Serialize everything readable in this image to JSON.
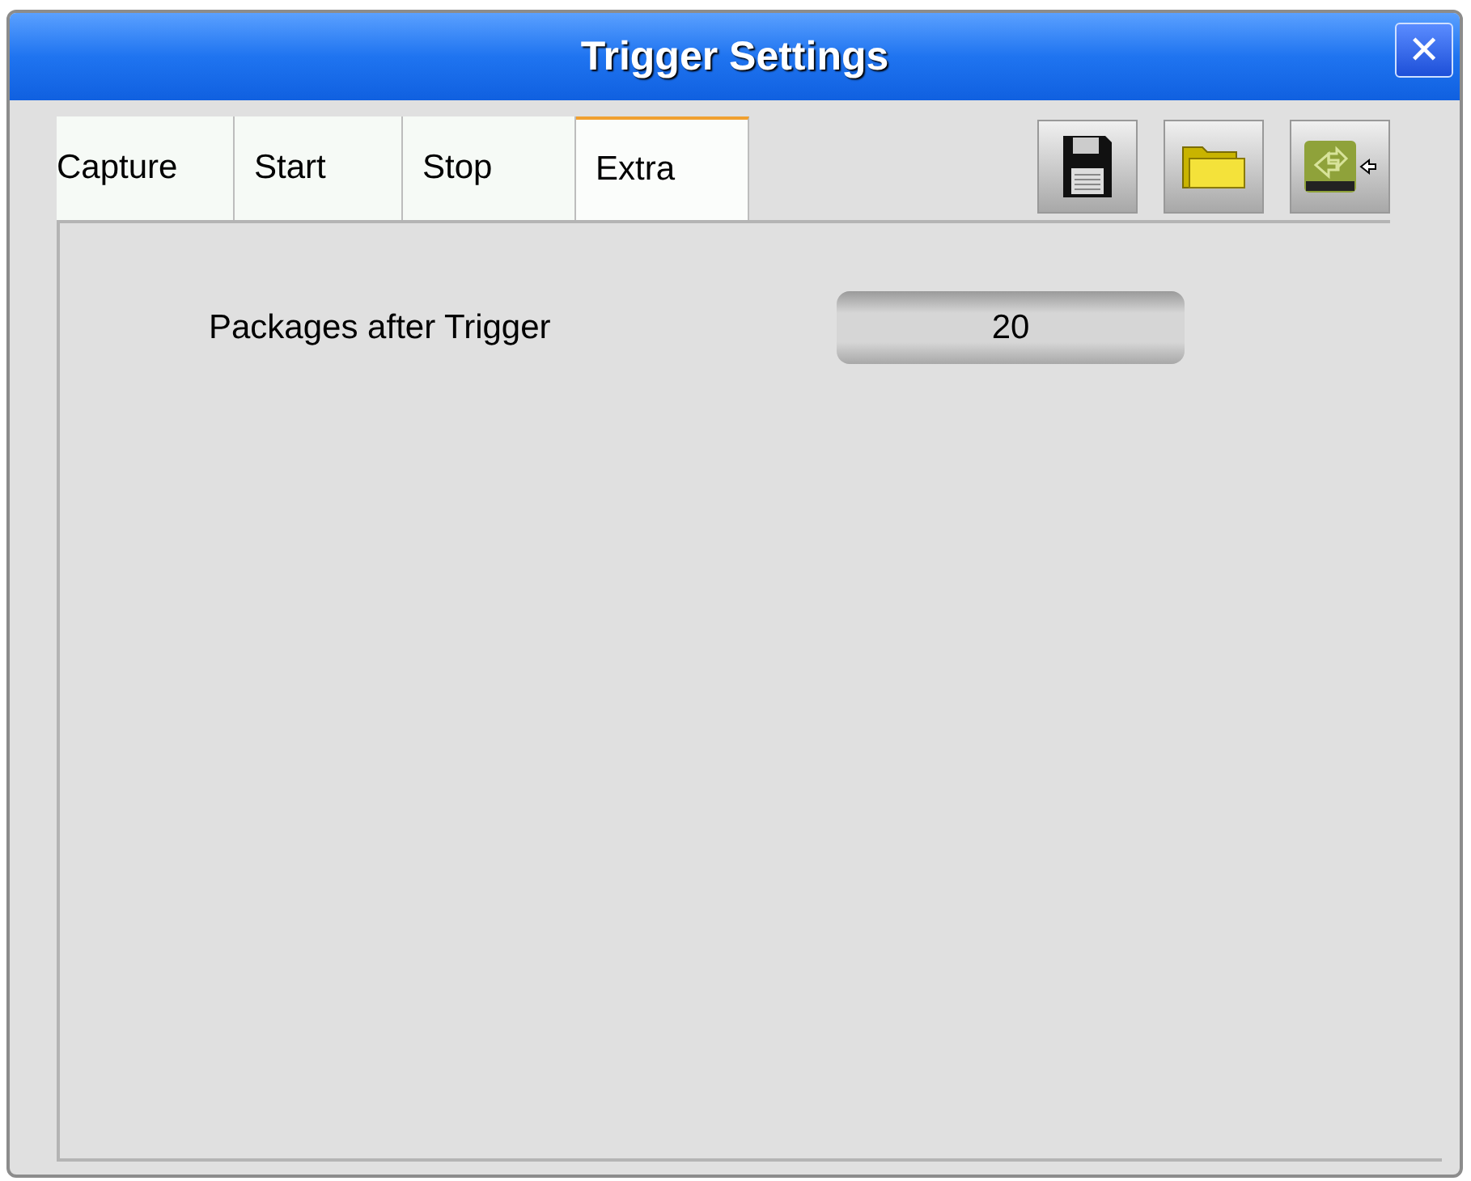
{
  "window": {
    "title": "Trigger Settings",
    "close": "✕"
  },
  "tabs": [
    {
      "label": "Capture",
      "selected": false
    },
    {
      "label": "Start",
      "selected": false
    },
    {
      "label": "Stop",
      "selected": false
    },
    {
      "label": "Extra",
      "selected": true
    }
  ],
  "fields": [
    {
      "label": "Packages after Trigger",
      "value": "20"
    }
  ]
}
